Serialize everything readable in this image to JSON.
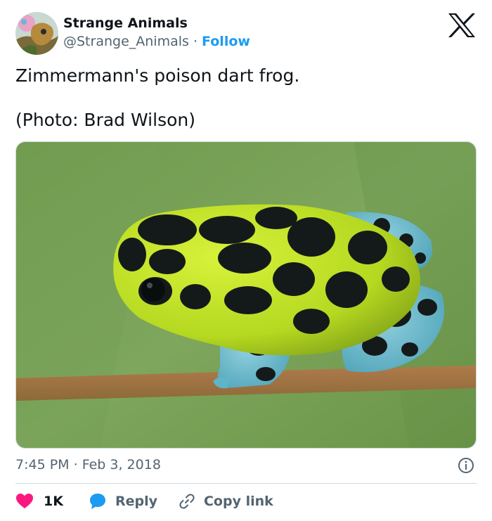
{
  "author": {
    "display_name": "Strange Animals",
    "handle": "@Strange_Animals",
    "separator": "·",
    "follow_label": "Follow",
    "avatar_icon": "avatar-image"
  },
  "brand": {
    "logo_icon": "x-logo-icon"
  },
  "tweet": {
    "line1": "Zimmermann's poison dart frog.",
    "line2": "(Photo: Brad Wilson)",
    "media_subject": "frog-photo"
  },
  "meta": {
    "time": "7:45 PM",
    "separator": "·",
    "date": "Feb 3, 2018",
    "info_icon": "info-icon"
  },
  "actions": {
    "like_count": "1K",
    "reply_label": "Reply",
    "copy_label": "Copy link",
    "like_icon": "heart-icon",
    "reply_icon": "speech-bubble-icon",
    "copy_icon": "link-icon"
  },
  "colors": {
    "accent": "#1d9bf0",
    "like": "#f91880",
    "text": "#0f1419",
    "secondary": "#536471"
  }
}
